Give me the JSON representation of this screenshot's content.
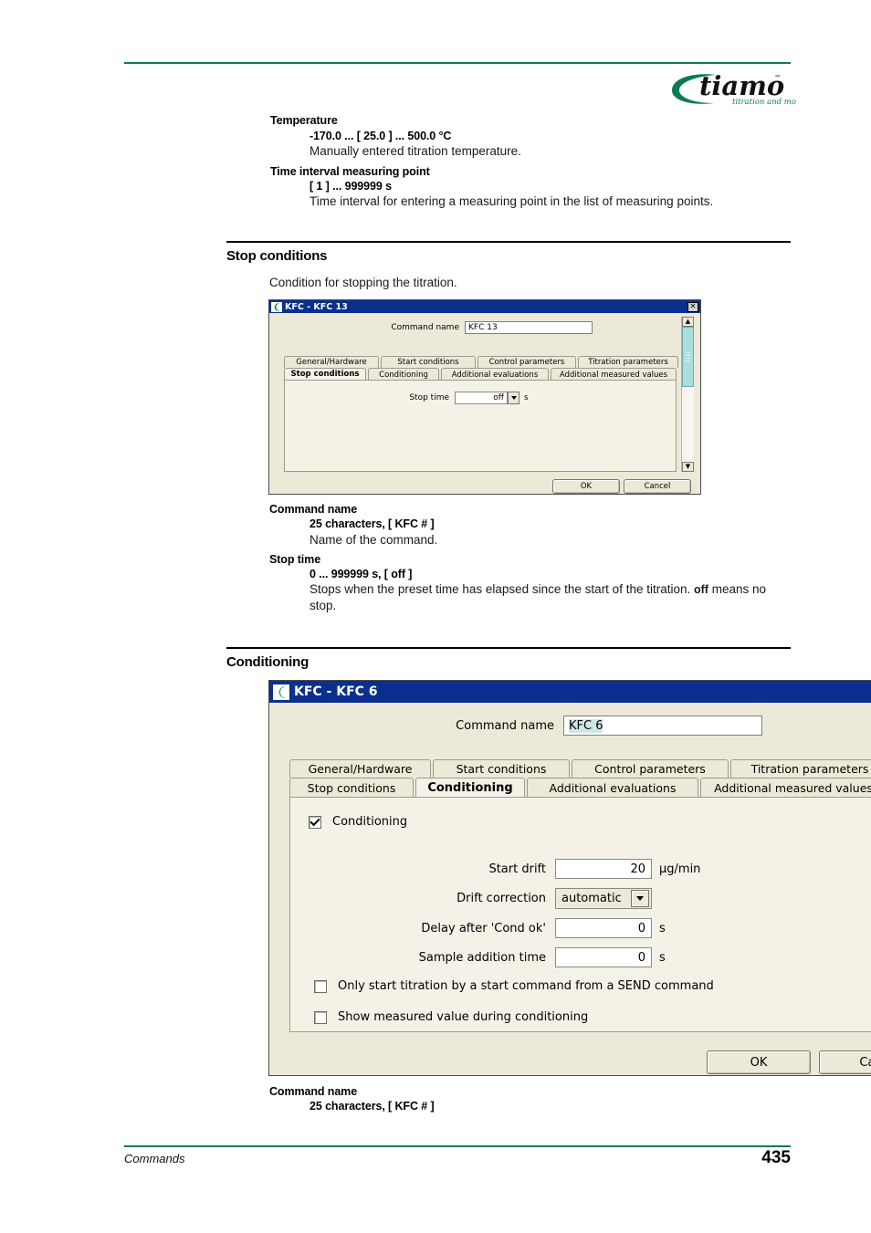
{
  "page": {
    "footer_left": "Commands",
    "page_number": "435",
    "brand": "tiamo",
    "brand_tm": "™",
    "brand_tagline": "titration and more",
    "accent_green": "#0d7a56"
  },
  "top_entries": [
    {
      "term": "Temperature",
      "range": "-170.0 ... [ 25.0 ] ... 500.0 °C",
      "desc": "Manually entered titration temperature."
    },
    {
      "term": "Time interval measuring point",
      "range": "[ 1 ] ... 999999 s",
      "desc": "Time interval for entering a measuring point in the list of measuring points."
    }
  ],
  "section_stop": {
    "title": "Stop conditions",
    "intro": "Condition for stopping the titration.",
    "entries": [
      {
        "term": "Command name",
        "range": "25 characters, [ KFC # ]",
        "desc": "Name of the command."
      },
      {
        "term": "Stop time",
        "range": "0 ... 999999 s, [ off ]",
        "desc_part1": "Stops when the preset time has elapsed since the start of the titration. ",
        "desc_bold": "off",
        "desc_part2": " means no stop."
      }
    ]
  },
  "section_conditioning": {
    "title": "Conditioning",
    "entries": [
      {
        "term": "Command name",
        "range": "25 characters, [ KFC # ]"
      }
    ]
  },
  "dialog1": {
    "title": "KFC - KFC 13",
    "close_label": "✕",
    "command_name_label": "Command name",
    "command_name_value": "KFC 13",
    "tabs_row1": [
      "General/Hardware",
      "Start conditions",
      "Control parameters",
      "Titration parameters"
    ],
    "tabs_row2": [
      "Stop conditions",
      "Conditioning",
      "Additional evaluations",
      "Additional measured values"
    ],
    "active_tab": "Stop conditions",
    "stop_time_label": "Stop time",
    "stop_time_value": "off",
    "stop_time_unit": "s",
    "ok_label": "OK",
    "cancel_label": "Cancel",
    "scroll_up": "▲",
    "scroll_down": "▼"
  },
  "dialog2": {
    "title": "KFC - KFC 6",
    "command_name_label": "Command name",
    "command_name_value": "KFC 6",
    "tabs_row1": [
      "General/Hardware",
      "Start conditions",
      "Control parameters",
      "Titration parameters"
    ],
    "tabs_row2": [
      "Stop conditions",
      "Conditioning",
      "Additional evaluations",
      "Additional measured values"
    ],
    "active_tab": "Conditioning",
    "conditioning_checkbox_label": "Conditioning",
    "conditioning_checked": true,
    "fields": [
      {
        "label": "Start drift",
        "value": "20",
        "unit": "µg/min",
        "type": "number"
      },
      {
        "label": "Drift correction",
        "value": "automatic",
        "unit": "",
        "type": "combo"
      },
      {
        "label": "Delay after 'Cond ok'",
        "value": "0",
        "unit": "s",
        "type": "number"
      },
      {
        "label": "Sample addition time",
        "value": "0",
        "unit": "s",
        "type": "number"
      }
    ],
    "checkboxes": [
      {
        "label": "Only start titration by a start command from a SEND command",
        "checked": false
      },
      {
        "label": "Show measured value during conditioning",
        "checked": false
      }
    ],
    "ok_label": "OK",
    "cancel_label": "Can"
  }
}
